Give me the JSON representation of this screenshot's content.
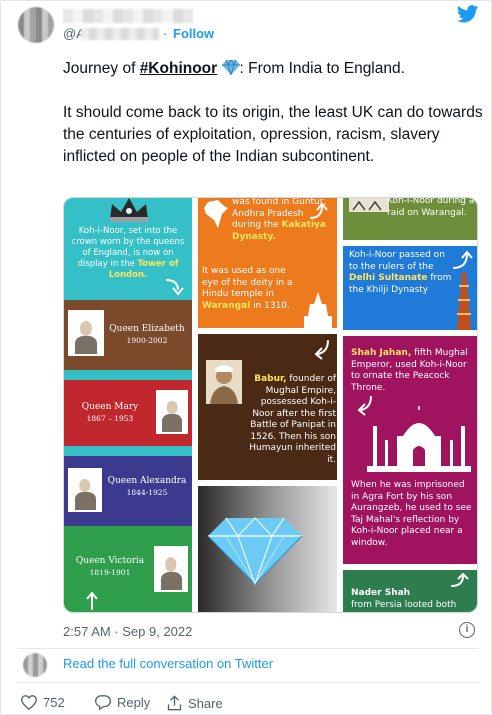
{
  "header": {
    "handle_prefix": "@A",
    "separator": "·",
    "follow_label": "Follow",
    "twitter_icon": "twitter-bird-icon"
  },
  "tweet": {
    "line1_prefix": "Journey of ",
    "hashtag": "#Kohinoor",
    "gem_icon": "gem-stone-icon",
    "line1_suffix": ": From India to England.",
    "paragraph2": "It should come back to its origin, the least UK can do towards the centuries of exploitation, opression, racism, slavery inflicted on people of the Indian subcontinent."
  },
  "infographic": {
    "crown_text_a": "Koh-i-Noor, set into the crown worn by the queens of England, is now on display in the ",
    "crown_text_b": "Tower of London.",
    "queens": [
      {
        "name": "Queen Elizabeth",
        "years": "1900-2002"
      },
      {
        "name": "Queen Mary",
        "years": "1867 – 1953"
      },
      {
        "name": "Queen Alexandra",
        "years": "1844-1925"
      },
      {
        "name": "Queen Victoria",
        "years": "1819-1901"
      }
    ],
    "orange_a": "was found in Guntur, Andhra Pradesh during the ",
    "orange_b": "Kakatiya Dynasty.",
    "orange_c": "It was used as one eye of the deity in a Hindu temple in ",
    "orange_d": "Warangal",
    "orange_e": " in 1310.",
    "babur_a": "Babur,",
    "babur_b": " founder of Mughal Empire, possessed Koh-i-Noor after the first Battle of Panipat in 1526. Then his son Humayun inherited it.",
    "green_top": "Koh-i-Noor during a raid on Warangal.",
    "blue_a": "Koh-i-Noor passed on to the rulers of the ",
    "blue_b": "Delhi Sultanate",
    "blue_c": " from the Khilji Dynasty",
    "shah_a": "Shah Jahan,",
    "shah_b": " fifth Mughal Emperor, used Koh-i-Noor to ornate the Peacock Throne.",
    "shah_c": "When he was imprisoned in Agra Fort by his son Aurangzeb, he used to see Taj Mahal's reflection by Koh-i-Noor placed near a window.",
    "nader_a": "Nader Shah",
    "nader_b": "from Persia looted both"
  },
  "footer": {
    "timestamp": "2:57 AM · Sep 9, 2022",
    "info_icon": "info-icon",
    "read_link": "Read the full conversation on Twitter",
    "like_count": "752",
    "reply_label": "Reply",
    "share_label": "Share"
  },
  "colors": {
    "accent": "#1d9bf0",
    "teal": "#35c0c8",
    "brown": "#7a4a2a",
    "red": "#c0282d",
    "purple": "#3b3a8f",
    "green": "#2e9e4a",
    "orange": "#ee7a1e",
    "dark_brown": "#4b2a15",
    "olive": "#6d8f3c",
    "blue": "#1f7ad8",
    "magenta": "#a0135f"
  }
}
